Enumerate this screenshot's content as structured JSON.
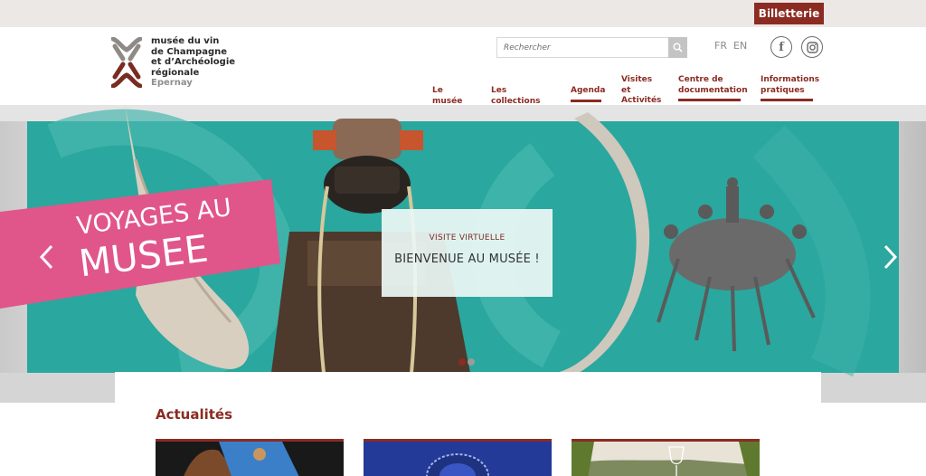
{
  "topbar": {
    "ticket_label": "Billetterie"
  },
  "logo": {
    "lines": [
      "musée du vin",
      "de Champagne",
      "et d’Archéologie",
      "régionale"
    ],
    "city": "Epernay",
    "brand_color": "#7a2c22"
  },
  "search": {
    "placeholder": "Rechercher",
    "icon": "search-icon"
  },
  "languages": [
    "FR",
    "EN"
  ],
  "social": [
    {
      "name": "facebook",
      "glyph": "f"
    },
    {
      "name": "instagram",
      "icon": "instagram-icon"
    }
  ],
  "nav": {
    "items": [
      {
        "label": "Le musée"
      },
      {
        "label": "Les collections"
      },
      {
        "label": "Agenda"
      },
      {
        "label": "Visites et",
        "label2": "Activités"
      },
      {
        "label": "Centre de",
        "label2": "documentation"
      },
      {
        "label": "Informations",
        "label2": "pratiques"
      }
    ]
  },
  "hero": {
    "banner_line1": "VOYAGES AU",
    "banner_line2": "MUSEE",
    "kicker": "VISITE VIRTUELLE",
    "title": "BIENVENUE AU MUSÉE !",
    "slides_total": 2,
    "active_slide": 1,
    "colors": {
      "teal": "#2aa79e",
      "pink": "#e0568b",
      "accent": "#8b2b21"
    }
  },
  "news": {
    "heading": "Actualités",
    "cards": 3
  }
}
